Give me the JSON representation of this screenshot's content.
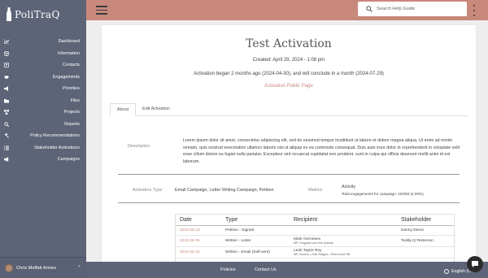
{
  "brand": {
    "name": "PoliTraQ"
  },
  "sidebar": {
    "items": [
      {
        "label": "Dashboard",
        "icon": "chart-icon"
      },
      {
        "label": "Information",
        "icon": "cube-icon"
      },
      {
        "label": "Contacts",
        "icon": "contacts-icon"
      },
      {
        "label": "Engagements",
        "icon": "handshake-icon"
      },
      {
        "label": "Priorities",
        "icon": "megaphone-icon"
      },
      {
        "label": "Files",
        "icon": "folder-icon"
      },
      {
        "label": "Projects",
        "icon": "project-icon"
      },
      {
        "label": "Reports",
        "icon": "search-icon"
      },
      {
        "label": "Policy Recommendations",
        "icon": "gavel-icon"
      },
      {
        "label": "Stakeholder Activations",
        "icon": "list-icon"
      },
      {
        "label": "Campaigns",
        "icon": "bullhorn-icon"
      }
    ],
    "user": {
      "name": "Chris Moffatt Armes"
    }
  },
  "topbar": {
    "search_placeholder": "Search Help Guide"
  },
  "activation": {
    "title": "Test Activation",
    "created": "Created: April 29, 2024 - 1:08 pm",
    "period": "Activation began 2 months ago (2024-04-30), and will conclude in a month (2024-07-29)",
    "public_link": "Activation Public Page",
    "tabs": [
      "About",
      "Edit Activation"
    ],
    "description_label": "Description",
    "description": "Lorem ipsum dolor sit amet, consectetur adipiscing elit, sed do eiusmod tempor incididunt ut labore et dolore magna aliqua. Ut enim ad minim veniam, quis nostrud exercitation ullamco laboris nisi ut aliquip ex ea commodo consequat. Duis aute irure dolor in reprehenderit in voluptate velit esse cillum dolore eu fugiat nulla pariatur. Excepteur sint occaecat cupidatat non proident, sunt in culpa qui officia deserunt mollit anim id est laborum.",
    "type_label": "Activation Type",
    "type_value": "Email Campaign, Letter Writing Campaign, Petition",
    "metrics_label": "Metrics",
    "metrics_title": "Activity",
    "metrics_detail": "Total engagements for campaign: 10/250 (4.00%)"
  },
  "table": {
    "headers": [
      "Date",
      "Type",
      "Recipient",
      "Stakeholder"
    ],
    "rows": [
      {
        "date": "2024-06-13",
        "type": "Petition - Signed",
        "recipient": "",
        "recipient_sub": "",
        "stakeholder": "Danny Demo"
      },
      {
        "date": "2024-06-05",
        "type": "Written - Letter",
        "recipient": "Mark Gerretsen",
        "recipient_sub": "MP, Kingston and the Islands",
        "stakeholder": "Teddy Q Testerson"
      },
      {
        "date": "2024-05-10",
        "type": "Written - Email (Self-sent)",
        "recipient": "Leah Taylor Roy",
        "recipient_sub": "MP, Aurora—Oak Ridges—Richmond Hill",
        "stakeholder": ""
      }
    ]
  },
  "footer": {
    "links": [
      "Policies",
      "Contact Us"
    ],
    "language": "English (C..."
  },
  "colors": {
    "accent": "#c8887b",
    "sidebar": "#5d6478"
  }
}
